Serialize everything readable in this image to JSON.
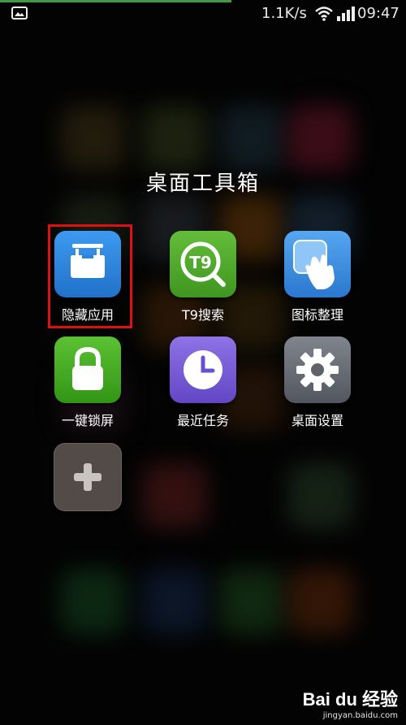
{
  "status_bar": {
    "network_speed": "1.1K/s",
    "time": "09:47",
    "icons": [
      "gallery-icon",
      "wifi-icon",
      "signal-icon"
    ]
  },
  "folder": {
    "title": "桌面工具箱",
    "apps": [
      {
        "label": "隐藏应用",
        "icon": "hide-apps-icon",
        "color": "#2f88e0"
      },
      {
        "label": "T9搜索",
        "icon": "t9-search-icon",
        "color": "#4ba72a"
      },
      {
        "label": "图标整理",
        "icon": "icon-arrange-icon",
        "color": "#3b8fe2"
      },
      {
        "label": "一键锁屏",
        "icon": "lock-icon",
        "color": "#45a51e"
      },
      {
        "label": "最近任务",
        "icon": "clock-icon",
        "color": "#7b5fd8"
      },
      {
        "label": "桌面设置",
        "icon": "gear-icon",
        "color": "#6b6f78"
      },
      {
        "label": "",
        "icon": "add-icon",
        "color": "#5a4f4a"
      }
    ]
  },
  "watermark": {
    "brand": "Bai du 经验",
    "site": "jingyan.baidu.com"
  }
}
